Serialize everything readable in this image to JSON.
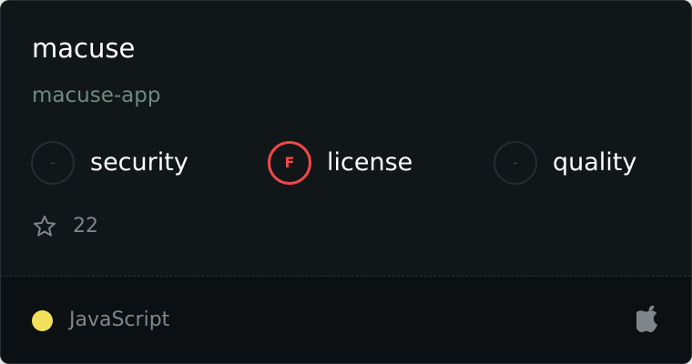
{
  "card": {
    "title": "macuse",
    "subtitle": "macuse-app"
  },
  "metrics": [
    {
      "label": "security",
      "grade": "-",
      "status": "none"
    },
    {
      "label": "license",
      "grade": "F",
      "status": "fail"
    },
    {
      "label": "quality",
      "grade": "-",
      "status": "none"
    }
  ],
  "stars": {
    "icon": "star-outline-icon",
    "count": "22"
  },
  "footer": {
    "language": "JavaScript",
    "language_color": "#f1e05a",
    "platform_icon": "apple-icon"
  },
  "colors": {
    "fail": "#f04848",
    "subtitle": "#6e8a7f"
  }
}
